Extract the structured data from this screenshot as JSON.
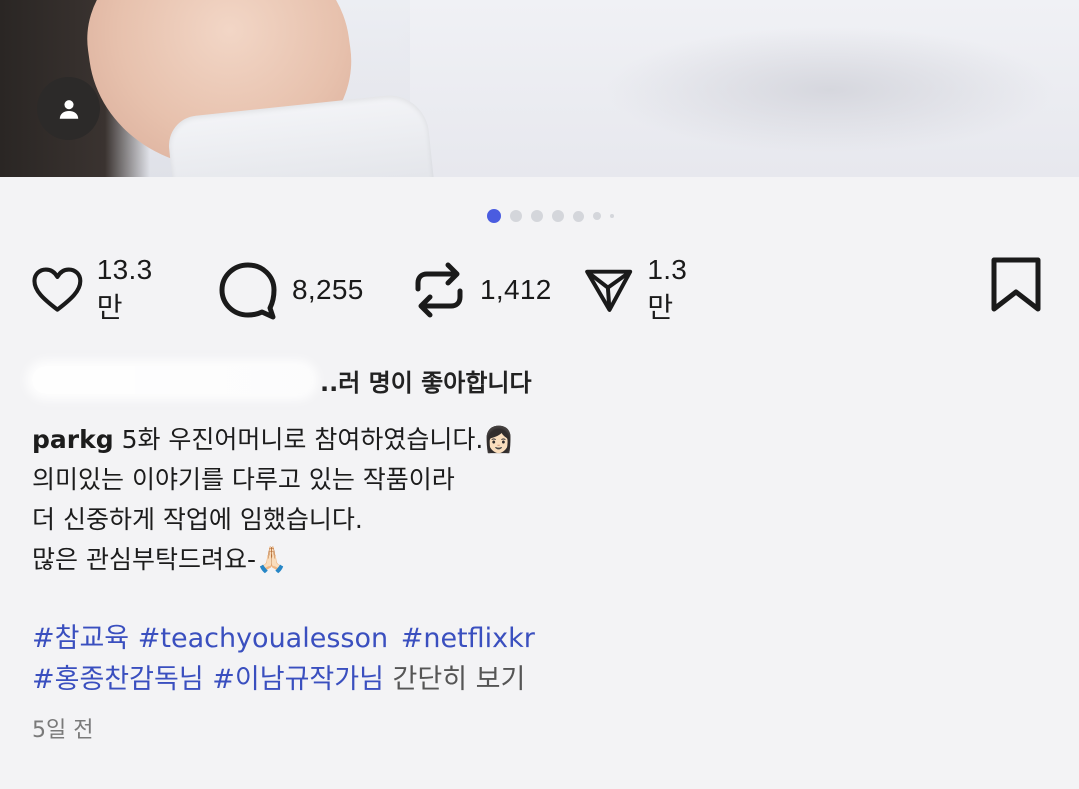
{
  "post": {
    "image_carousel": {
      "total": 7,
      "active_index": 0
    },
    "stats": {
      "likes": "13.3만",
      "comments": "8,255",
      "reposts": "1,412",
      "shares": "1.3만"
    },
    "liked_by_suffix": "..러 명이 좋아합니다",
    "caption": {
      "username": "parkg",
      "lines": [
        " 5화 우진어머니로 참여하였습니다.👩🏻",
        "의미있는 이야기를 다루고 있는 작품이라",
        "더 신중하게 작업에 임했습니다.",
        "많은 관심부탁드려요-🙏🏻"
      ]
    },
    "hashtags_line1": [
      "#참교육",
      "#teachyoualesson",
      "#netflixkr"
    ],
    "hashtags_line2": [
      "#홍종찬감독님",
      "#이남규작가님"
    ],
    "see_less": "간단히 보기",
    "timestamp": "5일 전"
  },
  "colors": {
    "accent_dot": "#4a5ce0",
    "hashtag": "#3a4fbf"
  },
  "icons": [
    "user-icon",
    "heart-icon",
    "comment-icon",
    "repost-icon",
    "share-icon",
    "bookmark-icon"
  ]
}
